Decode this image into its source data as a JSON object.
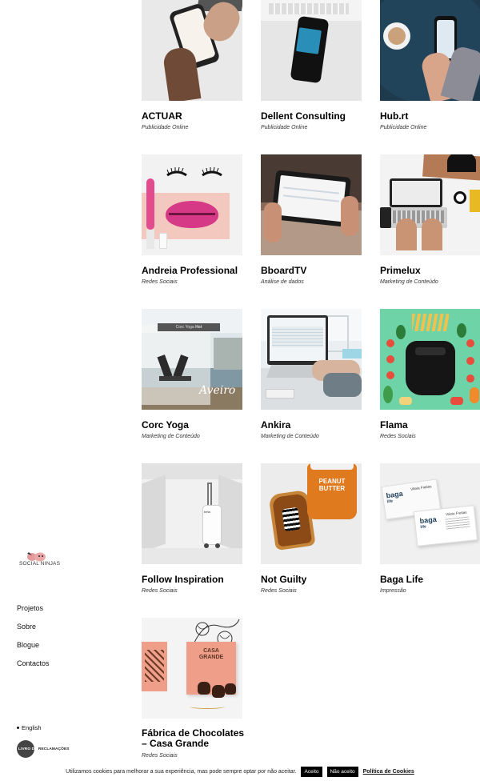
{
  "brand": {
    "logo_text": "SOCIAL NINJAS",
    "accent": "#e8a0a0"
  },
  "nav": [
    {
      "label": "Projetos"
    },
    {
      "label": "Sobre"
    },
    {
      "label": "Blogue"
    },
    {
      "label": "Contactos"
    }
  ],
  "language": {
    "label": "English"
  },
  "complaints": {
    "label_a": "LIVRO DE",
    "label_b": " RECLAMAÇÕES"
  },
  "projects": [
    {
      "title": "ACTUAR",
      "category": "Publicidade Online"
    },
    {
      "title": "Dellent Consulting",
      "category": "Publicidade Online"
    },
    {
      "title": "Hub.rt",
      "category": "Publicidade Online"
    },
    {
      "title": "Andreia Professional",
      "category": "Redes Sociais"
    },
    {
      "title": "BboardTV",
      "category": "Análise de dados"
    },
    {
      "title": "Primelux",
      "category": "Marketing de Conteúdo"
    },
    {
      "title": "Corc Yoga",
      "category": "Marketing de Conteúdo"
    },
    {
      "title": "Ankira",
      "category": "Marketing de Conteúdo"
    },
    {
      "title": "Flama",
      "category": "Redes Sociais"
    },
    {
      "title": "Follow Inspiration",
      "category": "Redes Sociais"
    },
    {
      "title": "Not Guilty",
      "category": "Redes Sociais"
    },
    {
      "title": "Baga Life",
      "category": "Impressão"
    },
    {
      "title": "Fábrica de Chocolates – Casa Grande",
      "category": "Redes Sociais"
    }
  ],
  "thumb_text": {
    "yoga_tag": "Corc Yoga",
    "yoga_tag_bold": "Hot",
    "yoga_script": "Aveiro",
    "suitcase_brand": "beta",
    "butter_top": "PEANUT",
    "butter_bottom": "BUTTER",
    "baga_logo": "baga",
    "baga_sub": "life",
    "baga_name": "Vânia Freitas",
    "choc_brand_top": "CASA",
    "choc_brand_bottom": "GRANDE"
  },
  "cookie": {
    "message": "Utilizamos cookies para melhorar a sua experiência, mas pode sempre optar por não aceitar.",
    "accept": "Aceito",
    "decline": "Não aceito",
    "policy": "Política de Cookies"
  },
  "colors": {
    "flama_bg": "#6fd3a8",
    "cookie_btn": "#000000",
    "hub_bg": "#1e3a4c"
  }
}
